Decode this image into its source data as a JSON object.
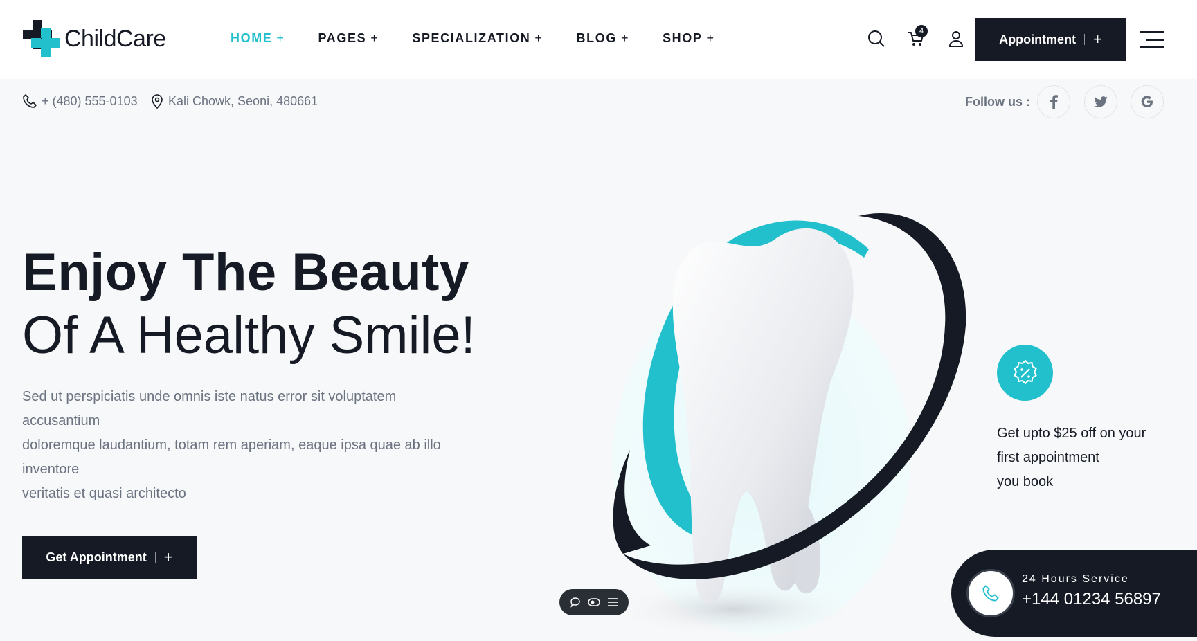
{
  "brand": {
    "name": "ChildCare",
    "accent": "#22bfcd",
    "dark": "#151a24"
  },
  "nav": {
    "items": [
      {
        "label": "HOME",
        "active": true
      },
      {
        "label": "PAGES",
        "active": false
      },
      {
        "label": "SPECIALIZATION",
        "active": false
      },
      {
        "label": "BLOG",
        "active": false
      },
      {
        "label": "SHOP",
        "active": false
      }
    ],
    "plus": "+"
  },
  "header": {
    "cart_count": "4",
    "appointment_label": "Appointment",
    "icons": [
      "search-icon",
      "cart-icon",
      "user-icon",
      "menu-icon"
    ]
  },
  "info_bar": {
    "phone": "+ (480) 555-0103",
    "address": "Kali Chowk, Seoni, 480661",
    "follow_label": "Follow us :",
    "social": [
      {
        "icon": "facebook-icon",
        "glyph": "f"
      },
      {
        "icon": "twitter-icon",
        "glyph": "t"
      },
      {
        "icon": "google-icon",
        "glyph": "G"
      }
    ]
  },
  "hero": {
    "line1": "Enjoy The Beauty",
    "line2": "Of A Healthy Smile!",
    "desc1": "Sed ut perspiciatis unde omnis iste natus error sit voluptatem accusantium",
    "desc2": "doloremque laudantium, totam rem aperiam, eaque ipsa quae ab illo inventore",
    "desc3": "veritatis et quasi architecto",
    "button_label": "Get Appointment"
  },
  "promo": {
    "line1": "Get upto $25 off on your",
    "line2": "first appointment",
    "line3": "you book"
  },
  "service": {
    "label": "24 Hours Service",
    "number": "+144 01234 56897"
  }
}
